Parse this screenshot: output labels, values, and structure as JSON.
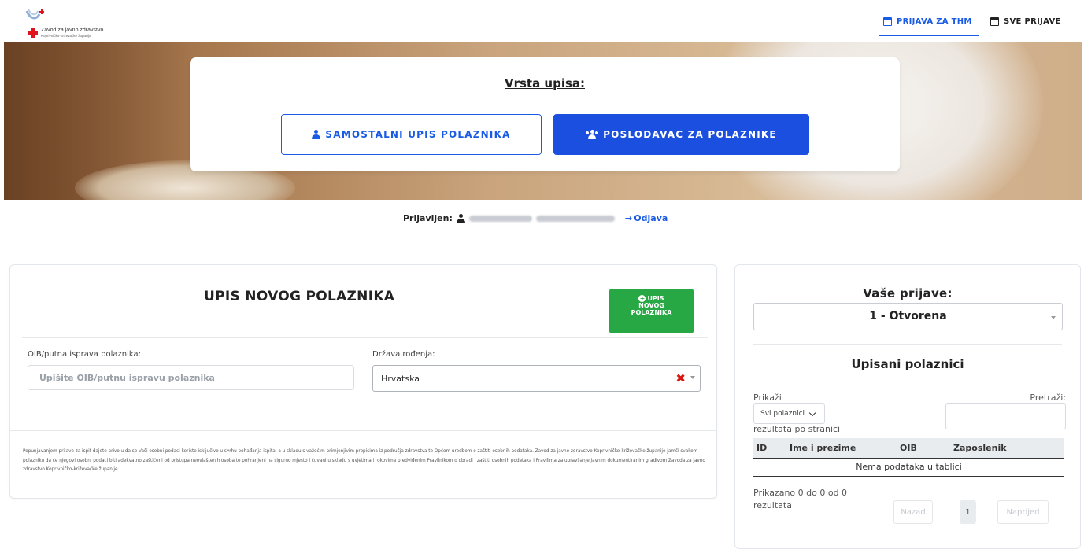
{
  "header": {
    "logo_line1": "Zavod za javno zdravstvo",
    "logo_line2": "Koprivničko-križevačke županije",
    "nav": [
      {
        "label": "PRIJAVA ZA THM",
        "active": true
      },
      {
        "label": "SVE PRIJAVE",
        "active": false
      }
    ]
  },
  "hero": {
    "title": "Vrsta upisa:",
    "option_self": "SAMOSTALNI UPIS POLAZNIKA",
    "option_employer": "POSLODAVAC ZA POLAZNIKE"
  },
  "session": {
    "label": "Prijavljen:",
    "logout": "Odjava"
  },
  "form": {
    "title": "UPIS NOVOG POLAZNIKA",
    "add_button": [
      "UPIS",
      "NOVOG",
      "POLAZNIKA"
    ],
    "oib_label": "OIB/putna isprava polaznika:",
    "oib_placeholder": "Upišite OIB/putnu ispravu polaznika",
    "country_label": "Država rođenja:",
    "country_value": "Hrvatska",
    "consent": "Popunjavanjem prijave za ispit dajete privolu da se Vaši osobni podaci koriste isključivo u svrhu pohađanja ispita, a u skladu s važećim primjenjivim propisima iz područja zdravstva te Općom uredbom o zaštiti osobnih podataka. Zavod za javno zdravstvo Koprivničko-križevačke županije jamči svakom polazniku da će njegovi osobni podaci biti adekvatno zaštićeni od pristupa neovlaštenih osoba te pohranjeni na sigurno mjesto i čuvani u skladu s uvjetima i rokovima predviđenim Pravilnikom o obradi i zaštiti osobnih podataka i Pravilima za upravljanje javnim dokumentiranim gradivom Zavoda za javno zdravstvo Koprivničko-križevačke županije."
  },
  "applications": {
    "title": "Vaše prijave:",
    "selected": "1 - Otvorena",
    "subtitle": "Upisani polaznici",
    "show_label": "Prikaži",
    "show_value": "Svi polaznici",
    "per_page_label": "rezultata po stranici",
    "search_label": "Pretraži:",
    "columns": [
      "ID",
      "Ime i prezime",
      "OIB",
      "Zaposlenik"
    ],
    "empty": "Nema podataka u tablici",
    "info": "Prikazano 0 do 0 od 0 rezultata",
    "prev": "Nazad",
    "page": "1",
    "next": "Naprijed"
  }
}
